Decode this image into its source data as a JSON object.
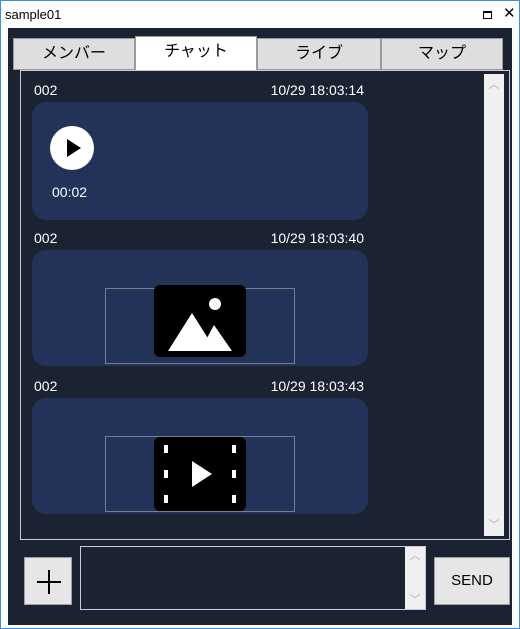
{
  "window": {
    "title": "sample01"
  },
  "tabs": [
    {
      "label": "メンバー",
      "active": false
    },
    {
      "label": "チャット",
      "active": true
    },
    {
      "label": "ライブ",
      "active": false
    },
    {
      "label": "マップ",
      "active": false
    }
  ],
  "messages": [
    {
      "sender": "002",
      "time": "10/29 18:03:14",
      "type": "audio",
      "duration": "00:02",
      "icon": "play-icon"
    },
    {
      "sender": "002",
      "time": "10/29 18:03:40",
      "type": "image",
      "icon": "image-icon"
    },
    {
      "sender": "002",
      "time": "10/29 18:03:43",
      "type": "video",
      "icon": "video-icon"
    }
  ],
  "composer": {
    "add_icon": "plus-icon",
    "input_value": "",
    "send_label": "SEND"
  },
  "colors": {
    "background": "#1b2232",
    "bubble": "#223258",
    "window_border": "#3a8fd8"
  }
}
